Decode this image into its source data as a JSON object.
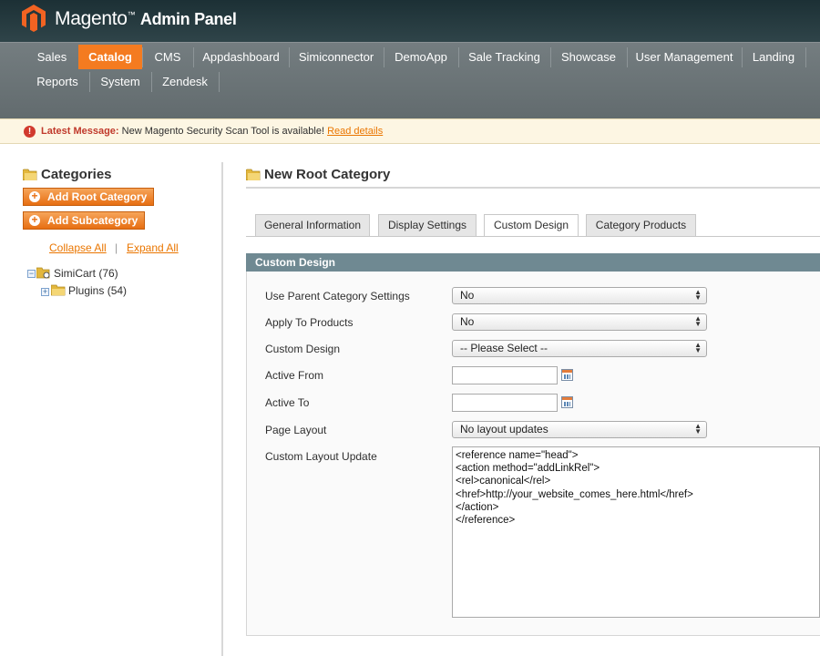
{
  "header": {
    "brand": "Magento",
    "brand_tm": "™",
    "subtitle": "Admin Panel"
  },
  "nav": {
    "row1": [
      "Sales",
      "Catalog",
      "CMS",
      "Appdashboard",
      "Simiconnector",
      "DemoApp",
      "Sale Tracking",
      "Showcase",
      "User Management",
      "Landing"
    ],
    "row2": [
      "Reports",
      "System",
      "Zendesk"
    ],
    "active": "Catalog"
  },
  "message": {
    "label": "Latest Message:",
    "text": "New Magento Security Scan Tool is available!",
    "link": "Read details"
  },
  "sidebar": {
    "title": "Categories",
    "add_root": "Add Root Category",
    "add_sub": "Add Subcategory",
    "collapse_all": "Collapse All",
    "separator": "|",
    "expand_all": "Expand All",
    "tree": [
      {
        "label": "SimiCart (76)"
      },
      {
        "label": "Plugins (54)"
      }
    ]
  },
  "main": {
    "title": "New Root Category",
    "tabs": [
      "General Information",
      "Display Settings",
      "Custom Design",
      "Category Products"
    ],
    "active_tab": "Custom Design",
    "section_title": "Custom Design",
    "fields": {
      "use_parent_label": "Use Parent Category Settings",
      "use_parent_value": "No",
      "apply_products_label": "Apply To Products",
      "apply_products_value": "No",
      "custom_design_label": "Custom Design",
      "custom_design_value": "-- Please Select --",
      "active_from_label": "Active From",
      "active_from_value": "",
      "active_to_label": "Active To",
      "active_to_value": "",
      "page_layout_label": "Page Layout",
      "page_layout_value": "No layout updates",
      "layout_update_label": "Custom Layout Update",
      "layout_update_value": "<reference name=\"head\">\n<action method=\"addLinkRel\">\n<rel>canonical</rel>\n<href>http://your_website_comes_here.html</href>\n</action>\n</reference>"
    }
  },
  "colors": {
    "accent": "#f47b20",
    "header": "#2c3f44",
    "nav": "#6a7477",
    "section_head": "#6f8992",
    "link": "#ea7601"
  }
}
